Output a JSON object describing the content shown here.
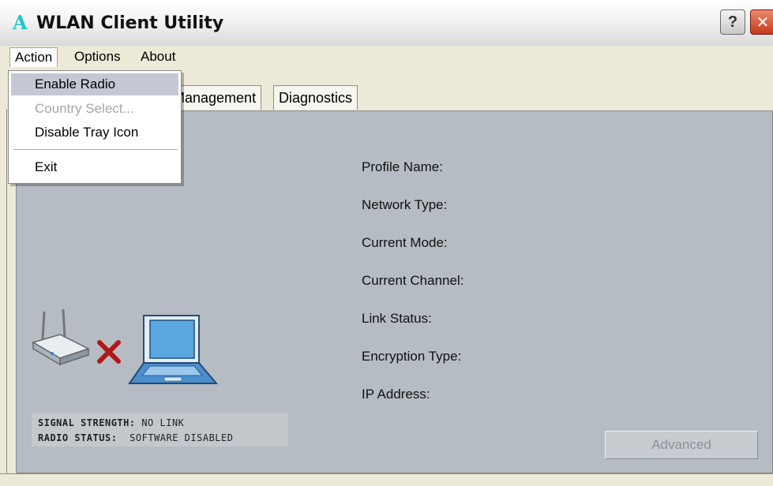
{
  "window": {
    "logo_glyph": "A",
    "title": "WLAN Client Utility",
    "help_glyph": "?",
    "close_glyph": "✕"
  },
  "menubar": {
    "items": [
      {
        "label": "Action",
        "active": true
      },
      {
        "label": "Options"
      },
      {
        "label": "About"
      }
    ]
  },
  "action_menu": {
    "items": [
      {
        "label": "Enable Radio",
        "state": "highlighted"
      },
      {
        "label": "Country Select...",
        "state": "disabled"
      },
      {
        "label": "Disable Tray Icon",
        "state": "normal"
      },
      {
        "label": "Exit",
        "state": "normal"
      }
    ]
  },
  "tabs": [
    {
      "label": "Management"
    },
    {
      "label": "Diagnostics"
    }
  ],
  "info": {
    "profile_name": "Profile Name:",
    "network_type": "Network Type:",
    "current_mode": "Current Mode:",
    "current_channel": "Current Channel:",
    "link_status": "Link Status:",
    "encryption_type": "Encryption Type:",
    "ip_address": "IP Address:"
  },
  "status": {
    "signal_label": "SIGNAL STRENGTH:",
    "signal_value": "NO LINK",
    "radio_label": "RADIO STATUS:",
    "radio_value": "SOFTWARE DISABLED"
  },
  "buttons": {
    "advanced": "Advanced"
  },
  "illustration": {
    "router_icon": "wireless-router-icon",
    "disconnect_icon": "red-x-icon",
    "laptop_icon": "laptop-icon"
  },
  "colors": {
    "panel": "#b6bcc3",
    "accent_red": "#b01818",
    "logo": "#1ec8c8"
  }
}
